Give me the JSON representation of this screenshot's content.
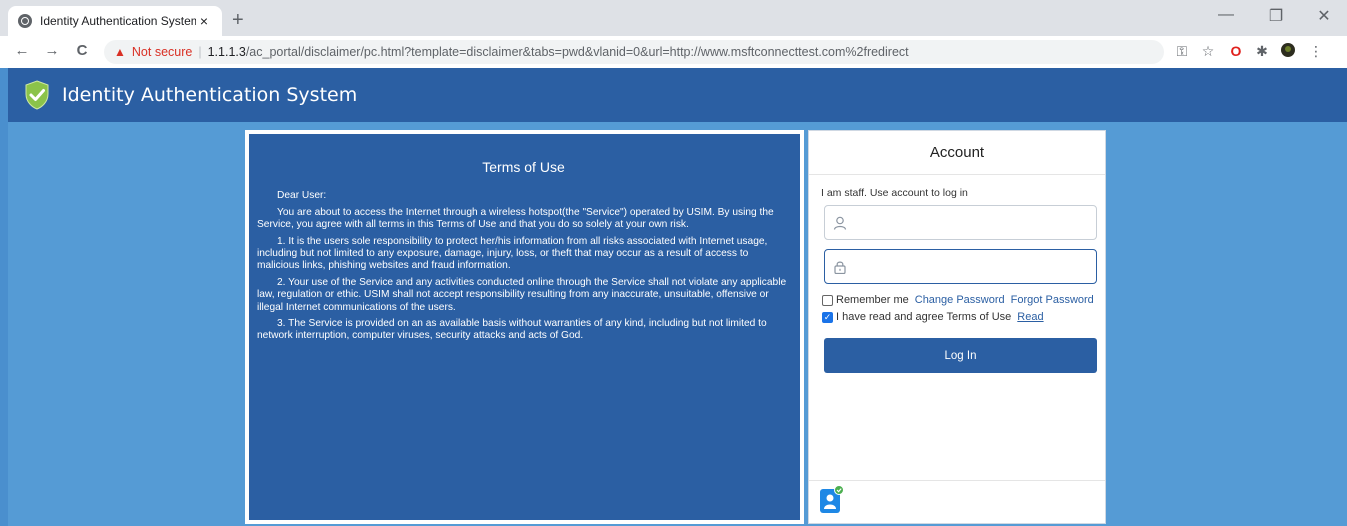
{
  "browser": {
    "tab_title": "Identity Authentication System",
    "tab_close": "×",
    "new_tab": "+",
    "minimize": "—",
    "restore": "❐",
    "close": "✕",
    "back": "←",
    "forward": "→",
    "reload": "C",
    "security_label": "Not secure",
    "separator": "|",
    "url_host": "1.1.1.3",
    "url_path": "/ac_portal/disclaimer/pc.html?template=disclaimer&tabs=pwd&vlanid=0&url=http://www.msftconnecttest.com%2fredirect",
    "icons": [
      "key-icon",
      "star-icon",
      "opera-icon",
      "puzzle-icon",
      "profile-icon",
      "menu-icon"
    ]
  },
  "header": {
    "title": "Identity Authentication System"
  },
  "terms": {
    "title": "Terms of Use",
    "greeting": "Dear User:",
    "paragraphs": [
      "You are about to access the Internet through a wireless hotspot(the \"Service\") operated by USIM. By using the Service, you agree with all terms in this Terms of Use and that you do so solely at your own risk.",
      "1. It is the users sole responsibility to protect her/his information from all risks associated with Internet usage, including but not limited to any exposure, damage, injury, loss, or theft that may occur as a result of access to malicious links, phishing websites and fraud information.",
      "2. Your use of the Service and any activities conducted online through the Service shall not violate any applicable law, regulation or ethic. USIM shall not accept responsibility resulting from any inaccurate, unsuitable, offensive or illegal Internet communications of the users.",
      "3. The Service is provided on an as available basis without warranties of any kind, including but not limited to network interruption, computer viruses, security attacks and acts of God."
    ]
  },
  "login": {
    "title": "Account",
    "subtitle": "I am staff. Use account to log in",
    "username_value": "",
    "password_value": "",
    "remember_label": "Remember me",
    "remember_checked": false,
    "change_password": "Change Password",
    "forgot_password": "Forgot Password",
    "agree_label": "I have read and agree Terms of Use",
    "agree_checked": true,
    "read_link": "Read",
    "login_button": "Log In"
  },
  "colors": {
    "brand": "#2b5fa3",
    "page_bg": "#559bd5",
    "warning": "#d93025"
  }
}
